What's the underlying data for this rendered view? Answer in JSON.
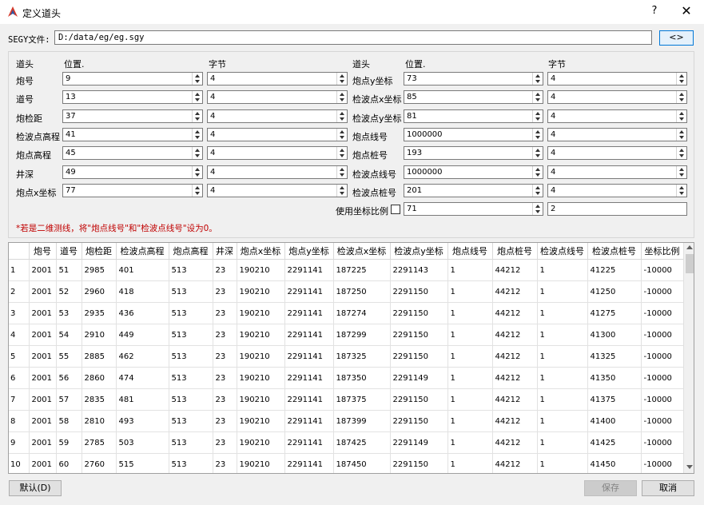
{
  "window": {
    "title": "定义道头",
    "help_glyph": "?",
    "close_glyph": "✕",
    "icon": "app-logo-icon"
  },
  "segy": {
    "label": "SEGY文件:",
    "path": "D:/data/eg/eg.sgy",
    "browse_label": "<>"
  },
  "headers_left": {
    "col_name": "道头",
    "col_pos": "位置.",
    "col_bytes": "字节"
  },
  "headers_right": {
    "col_name": "道头",
    "col_pos": "位置.",
    "col_bytes": "字节"
  },
  "fields_left": [
    {
      "label": "炮号",
      "pos": "9",
      "bytes": "4"
    },
    {
      "label": "道号",
      "pos": "13",
      "bytes": "4"
    },
    {
      "label": "炮检距",
      "pos": "37",
      "bytes": "4"
    },
    {
      "label": "检波点高程",
      "pos": "41",
      "bytes": "4"
    },
    {
      "label": "炮点高程",
      "pos": "45",
      "bytes": "4"
    },
    {
      "label": "井深",
      "pos": "49",
      "bytes": "4"
    },
    {
      "label": "炮点x坐标",
      "pos": "77",
      "bytes": "4"
    }
  ],
  "fields_right": [
    {
      "label": "炮点y坐标",
      "pos": "73",
      "bytes": "4"
    },
    {
      "label": "检波点x坐标",
      "pos": "85",
      "bytes": "4"
    },
    {
      "label": "检波点y坐标",
      "pos": "81",
      "bytes": "4"
    },
    {
      "label": "炮点线号",
      "pos": "1000000",
      "bytes": "4"
    },
    {
      "label": "炮点桩号",
      "pos": "193",
      "bytes": "4"
    },
    {
      "label": "检波点线号",
      "pos": "1000000",
      "bytes": "4"
    },
    {
      "label": "检波点桩号",
      "pos": "201",
      "bytes": "4"
    }
  ],
  "coord_scale": {
    "label": "使用坐标比例",
    "checked": false,
    "pos": "71",
    "bytes": "2"
  },
  "note": "*若是二维测线，将\"炮点线号\"和\"检波点线号\"设为0。",
  "table": {
    "columns": [
      "炮号",
      "道号",
      "炮检距",
      "检波点高程",
      "炮点高程",
      "井深",
      "炮点x坐标",
      "炮点y坐标",
      "检波点x坐标",
      "检波点y坐标",
      "炮点线号",
      "炮点桩号",
      "检波点线号",
      "检波点桩号",
      "坐标比例"
    ],
    "rows": [
      [
        "1",
        "2001",
        "51",
        "2985",
        "401",
        "513",
        "23",
        "190210",
        "2291141",
        "187225",
        "2291143",
        "1",
        "44212",
        "1",
        "41225",
        "-10000"
      ],
      [
        "2",
        "2001",
        "52",
        "2960",
        "418",
        "513",
        "23",
        "190210",
        "2291141",
        "187250",
        "2291150",
        "1",
        "44212",
        "1",
        "41250",
        "-10000"
      ],
      [
        "3",
        "2001",
        "53",
        "2935",
        "436",
        "513",
        "23",
        "190210",
        "2291141",
        "187274",
        "2291150",
        "1",
        "44212",
        "1",
        "41275",
        "-10000"
      ],
      [
        "4",
        "2001",
        "54",
        "2910",
        "449",
        "513",
        "23",
        "190210",
        "2291141",
        "187299",
        "2291150",
        "1",
        "44212",
        "1",
        "41300",
        "-10000"
      ],
      [
        "5",
        "2001",
        "55",
        "2885",
        "462",
        "513",
        "23",
        "190210",
        "2291141",
        "187325",
        "2291150",
        "1",
        "44212",
        "1",
        "41325",
        "-10000"
      ],
      [
        "6",
        "2001",
        "56",
        "2860",
        "474",
        "513",
        "23",
        "190210",
        "2291141",
        "187350",
        "2291149",
        "1",
        "44212",
        "1",
        "41350",
        "-10000"
      ],
      [
        "7",
        "2001",
        "57",
        "2835",
        "481",
        "513",
        "23",
        "190210",
        "2291141",
        "187375",
        "2291150",
        "1",
        "44212",
        "1",
        "41375",
        "-10000"
      ],
      [
        "8",
        "2001",
        "58",
        "2810",
        "493",
        "513",
        "23",
        "190210",
        "2291141",
        "187399",
        "2291150",
        "1",
        "44212",
        "1",
        "41400",
        "-10000"
      ],
      [
        "9",
        "2001",
        "59",
        "2785",
        "503",
        "513",
        "23",
        "190210",
        "2291141",
        "187425",
        "2291149",
        "1",
        "44212",
        "1",
        "41425",
        "-10000"
      ],
      [
        "10",
        "2001",
        "60",
        "2760",
        "515",
        "513",
        "23",
        "190210",
        "2291141",
        "187450",
        "2291150",
        "1",
        "44212",
        "1",
        "41450",
        "-10000"
      ]
    ]
  },
  "buttons": {
    "default_label": "默认(D)",
    "save_label": "保存",
    "cancel_label": "取消",
    "save_enabled": false
  }
}
